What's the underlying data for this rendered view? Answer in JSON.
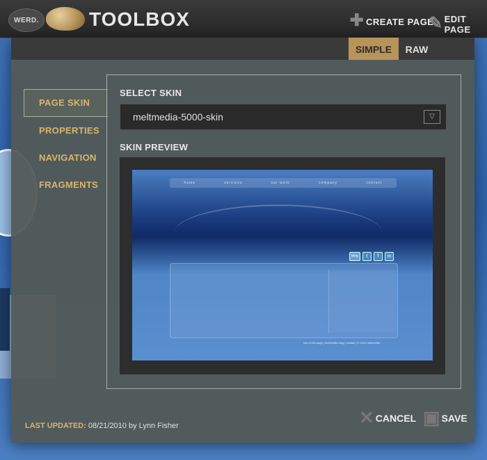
{
  "topbar": {
    "badge": "WERD.",
    "brand": "TOOLBOX",
    "create_page": "CREATE PAGE",
    "edit_page": "EDIT PAGE"
  },
  "modes": {
    "simple": "SIMPLE",
    "raw": "RAW",
    "active": "SIMPLE"
  },
  "nav": {
    "items": [
      {
        "label": "PAGE SKIN",
        "active": true
      },
      {
        "label": "PROPERTIES"
      },
      {
        "label": "NAVIGATION"
      },
      {
        "label": "FRAGMENTS"
      }
    ]
  },
  "skin": {
    "select_label": "SELECT SKIN",
    "selected": "meltmedia-5000-skin",
    "preview_label": "SKIN PREVIEW"
  },
  "preview": {
    "nav": [
      "home",
      "services",
      "our work",
      "company",
      "contact"
    ],
    "social": [
      "blog",
      "t",
      "f",
      "in"
    ],
    "footer": "link to this page | meltmedia blog | contact | © 2010 meltmedia"
  },
  "footer": {
    "updated_label": "LAST UPDATED:",
    "updated_value": "08/21/2010 by Lynn Fisher",
    "cancel": "CANCEL",
    "save": "SAVE"
  },
  "colors": {
    "accent": "#b8945a",
    "nav_text": "#d9b56d",
    "modal_bg": "#525a56"
  }
}
